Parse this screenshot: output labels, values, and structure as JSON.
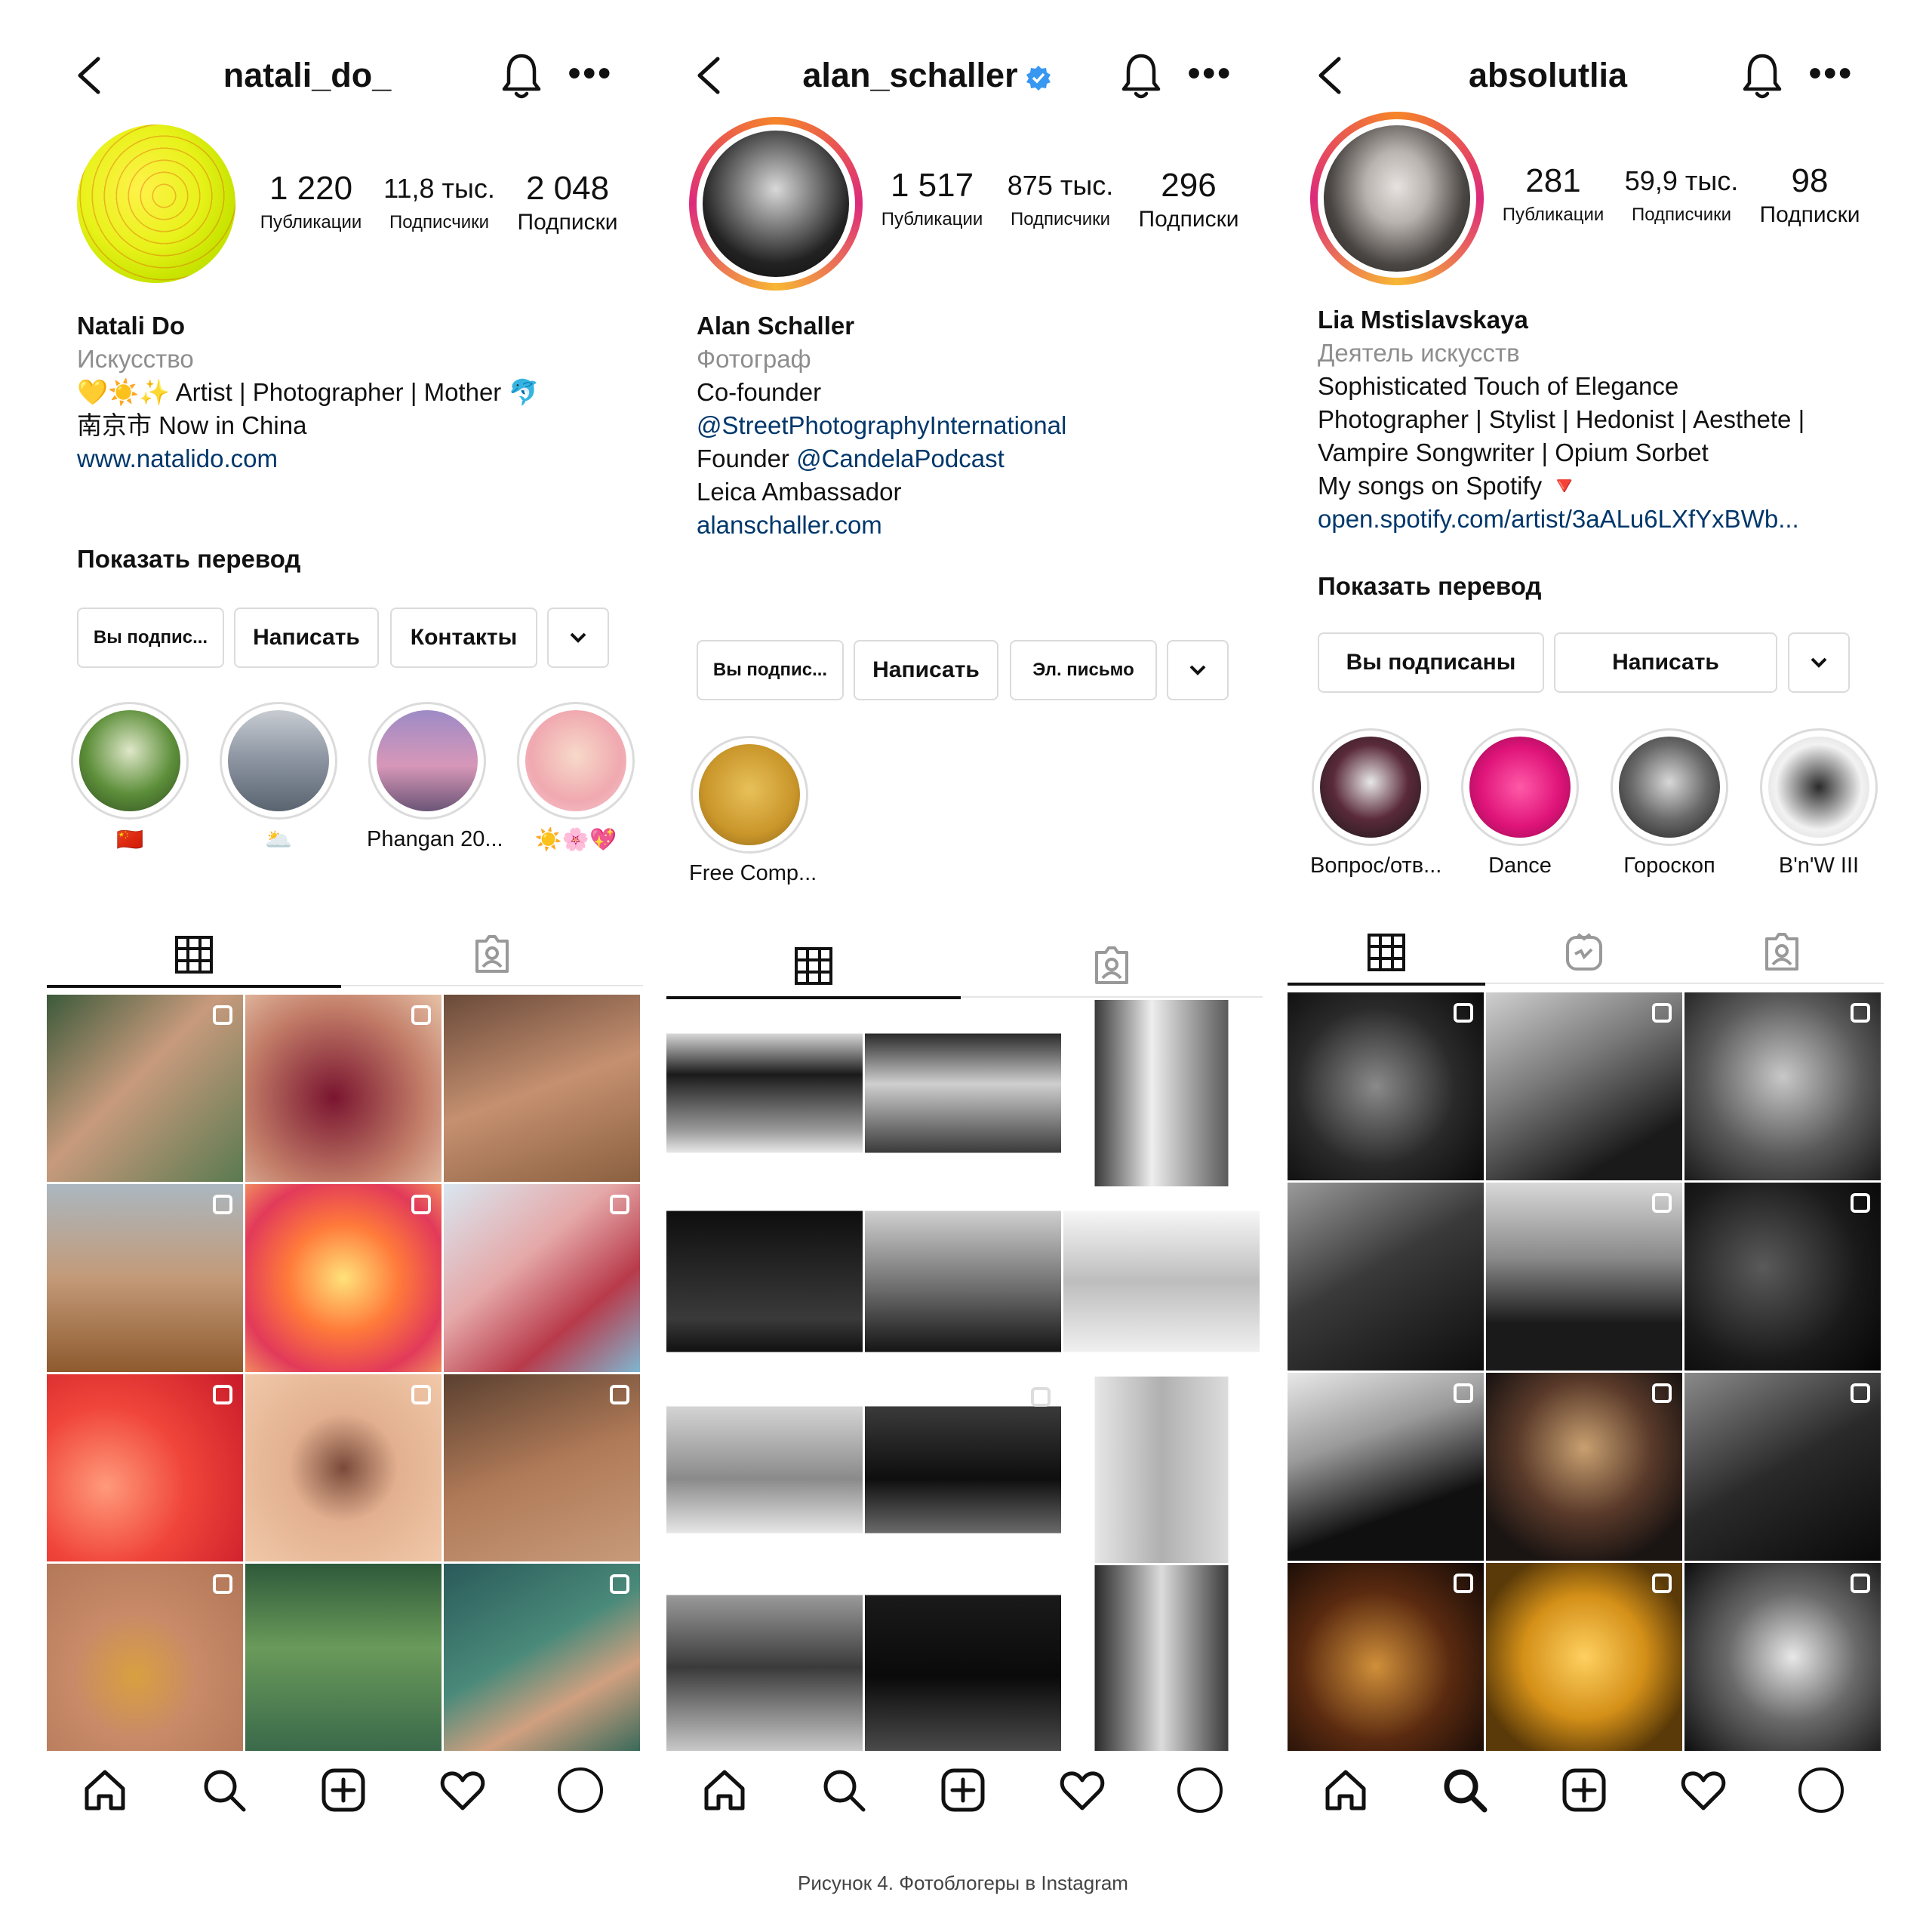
{
  "panels": [
    {
      "username": "natali_do_",
      "stats": [
        {
          "num": "1 220",
          "label": "Публикации"
        },
        {
          "num": "11,8 тыс.",
          "label": "Подписчики"
        },
        {
          "num": "2 048",
          "label": "Подписки"
        }
      ],
      "bio": {
        "name": "Natali Do",
        "category": "Искусство",
        "lines": [
          "💛☀️✨ Artist | Photographer | Mother 🐬",
          "南京市 Now in China"
        ],
        "link": "www.natalido.com"
      },
      "translate": "Показать перевод",
      "buttons": [
        "Вы подпис...",
        "Написать",
        "Контакты"
      ],
      "highlights": [
        {
          "label": "🇨🇳"
        },
        {
          "label": "🌥️"
        },
        {
          "label": "Phangan 20..."
        },
        {
          "label": "☀️🌸💖"
        }
      ]
    },
    {
      "username": "alan_schaller",
      "stats": [
        {
          "num": "1 517",
          "label": "Публикации"
        },
        {
          "num": "875 тыс.",
          "label": "Подписчики"
        },
        {
          "num": "296",
          "label": "Подписки"
        }
      ],
      "bio": {
        "name": "Alan Schaller",
        "category": "Фотограф",
        "line1": "Co-founder",
        "mention1": "@StreetPhotographyInternational",
        "founder_prefix": "Founder",
        "mention2": "@CandelaPodcast",
        "line4": "Leica Ambassador",
        "link": "alanschaller.com"
      },
      "buttons": [
        "Вы подпис...",
        "Написать",
        "Эл. письмо"
      ],
      "highlights": [
        {
          "label": "Free Comp..."
        }
      ]
    },
    {
      "username": "absolutlia",
      "stats": [
        {
          "num": "281",
          "label": "Публикации"
        },
        {
          "num": "59,9 тыс.",
          "label": "Подписчики"
        },
        {
          "num": "98",
          "label": "Подписки"
        }
      ],
      "bio": {
        "name": "Lia Mstislavskaya",
        "category": "Деятель искусств",
        "lines": [
          "Sophisticated Touch of Elegance",
          "Photographer | Stylist | Hedonist | Aesthete |",
          "Vampire Songwriter | Opium Sorbet",
          "My songs on Spotify 🔻"
        ],
        "link": "open.spotify.com/artist/3aALu6LXfYxBWb..."
      },
      "translate": "Показать перевод",
      "buttons": [
        "Вы подписаны",
        "Написать"
      ],
      "highlights": [
        {
          "label": "Вопрос/отв..."
        },
        {
          "label": "Dance"
        },
        {
          "label": "Гороскоп"
        },
        {
          "label": "B'n'W III"
        }
      ]
    }
  ],
  "caption": "Рисунок 4. Фотоблогеры в Instagram",
  "colors": {
    "link": "#00376b",
    "secondary": "#8e8e8e",
    "verified": "#3897f0",
    "border": "#dbdbdb"
  },
  "icons": [
    "back-arrow-icon",
    "bell-icon",
    "more-icon",
    "verified-badge-icon",
    "grid-icon",
    "tagged-icon",
    "reels-icon",
    "home-icon",
    "search-icon",
    "new-post-icon",
    "heart-icon",
    "profile-icon",
    "chevron-down-icon"
  ]
}
